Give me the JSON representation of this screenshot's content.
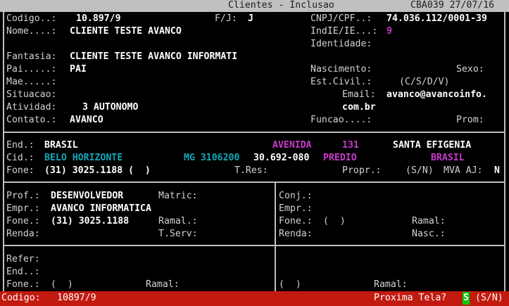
{
  "header": {
    "title": "Clientes - Inclusao",
    "code_date": "CBA039 27/07/16"
  },
  "form": {
    "codigo_label": "Codigo..:",
    "codigo_value": "10.897/9",
    "fj_label": "F/J:",
    "fj_value": "J",
    "cnpj_label": "CNPJ/CPF..:",
    "cnpj_value": "74.036.112/0001-39",
    "nome_label": "Nome....:",
    "nome_value": "CLIENTE TESTE AVANCO",
    "indie_label": "IndIE/IE...:",
    "indie_value": "9",
    "identidade_label": "Identidade:",
    "fantasia_label": "Fantasia:",
    "fantasia_value": "CLIENTE TESTE AVANCO INFORMATI",
    "pai_label": "Pai.....:",
    "pai_value": "PAI",
    "nascimento_label": "Nascimento:",
    "sexo_label": "Sexo:",
    "mae_label": "Mae.....:",
    "estcivil_label": "Est.Civil.:",
    "estcivil_options": "(C/S/D/V)",
    "situacao_label": "Situacao:",
    "email_label": "Email:",
    "email_value_1": "avanco@avancoinfo.",
    "email_value_2": "com.br",
    "atividade_label": "Atividad:",
    "atividade_value": "3 AUTONOMO",
    "contato_label": "Contato.:",
    "contato_value": "AVANCO",
    "funcao_label": "Funcao....:",
    "prom_label": "Prom:"
  },
  "address": {
    "end_label": "End.:",
    "end_value": "BRASIL",
    "street_type": "AVENIDA",
    "street_number": "131",
    "neighborhood": "SANTA EFIGENIA",
    "cid_label": "Cid.:",
    "city": "BELO HORIZONTE",
    "state_code": "MG 3106200",
    "cep": "30.692-080",
    "building_type": "PREDIO",
    "country": "BRASIL",
    "fone_label": "Fone:",
    "fone_value": "(31) 3025.1188 (  )",
    "tres_label": "T.Res:",
    "propr_label": "Propr.:",
    "propr_options": "(S/N)",
    "mva_label": "MVA AJ:",
    "mva_value": "N"
  },
  "work": {
    "prof_label": "Prof.:",
    "prof_value": "DESENVOLVEDOR",
    "matric_label": "Matric:",
    "empr_label": "Empr.:",
    "empr_value": "AVANCO INFORMATICA",
    "fone_label": "Fone.:",
    "fone_value": "(31) 3025.1188",
    "ramal_label": "Ramal.:",
    "renda_label": "Renda:",
    "tserv_label": "T.Serv:"
  },
  "spouse": {
    "conj_label": "Conj.:",
    "empr_label": "Empr.:",
    "fone_label": "Fone.:",
    "fone_value": "(  )",
    "ramal_label": "Ramal:",
    "renda_label": "Renda:",
    "nasc_label": "Nasc.:"
  },
  "reference": {
    "refer_label": "Refer:",
    "end_label": "End..:",
    "fone_label": "Fone.:",
    "fone_value": "(  )",
    "ramal_label": "Ramal:",
    "fone2_value": "(  )",
    "ramal2_label": "Ramal:"
  },
  "footer": {
    "codigo_label": "Codigo:",
    "codigo_value": "10897/9",
    "prompt_label": "Proxima Tela?",
    "prompt_value": "S",
    "prompt_options": "(S/N)"
  },
  "colors": {
    "header_bg": "#c0c0c0",
    "footer_bg": "#c21a0f",
    "magenta": "#c93ac9",
    "cyan": "#11a8b8",
    "cursor": "#00cc00"
  }
}
